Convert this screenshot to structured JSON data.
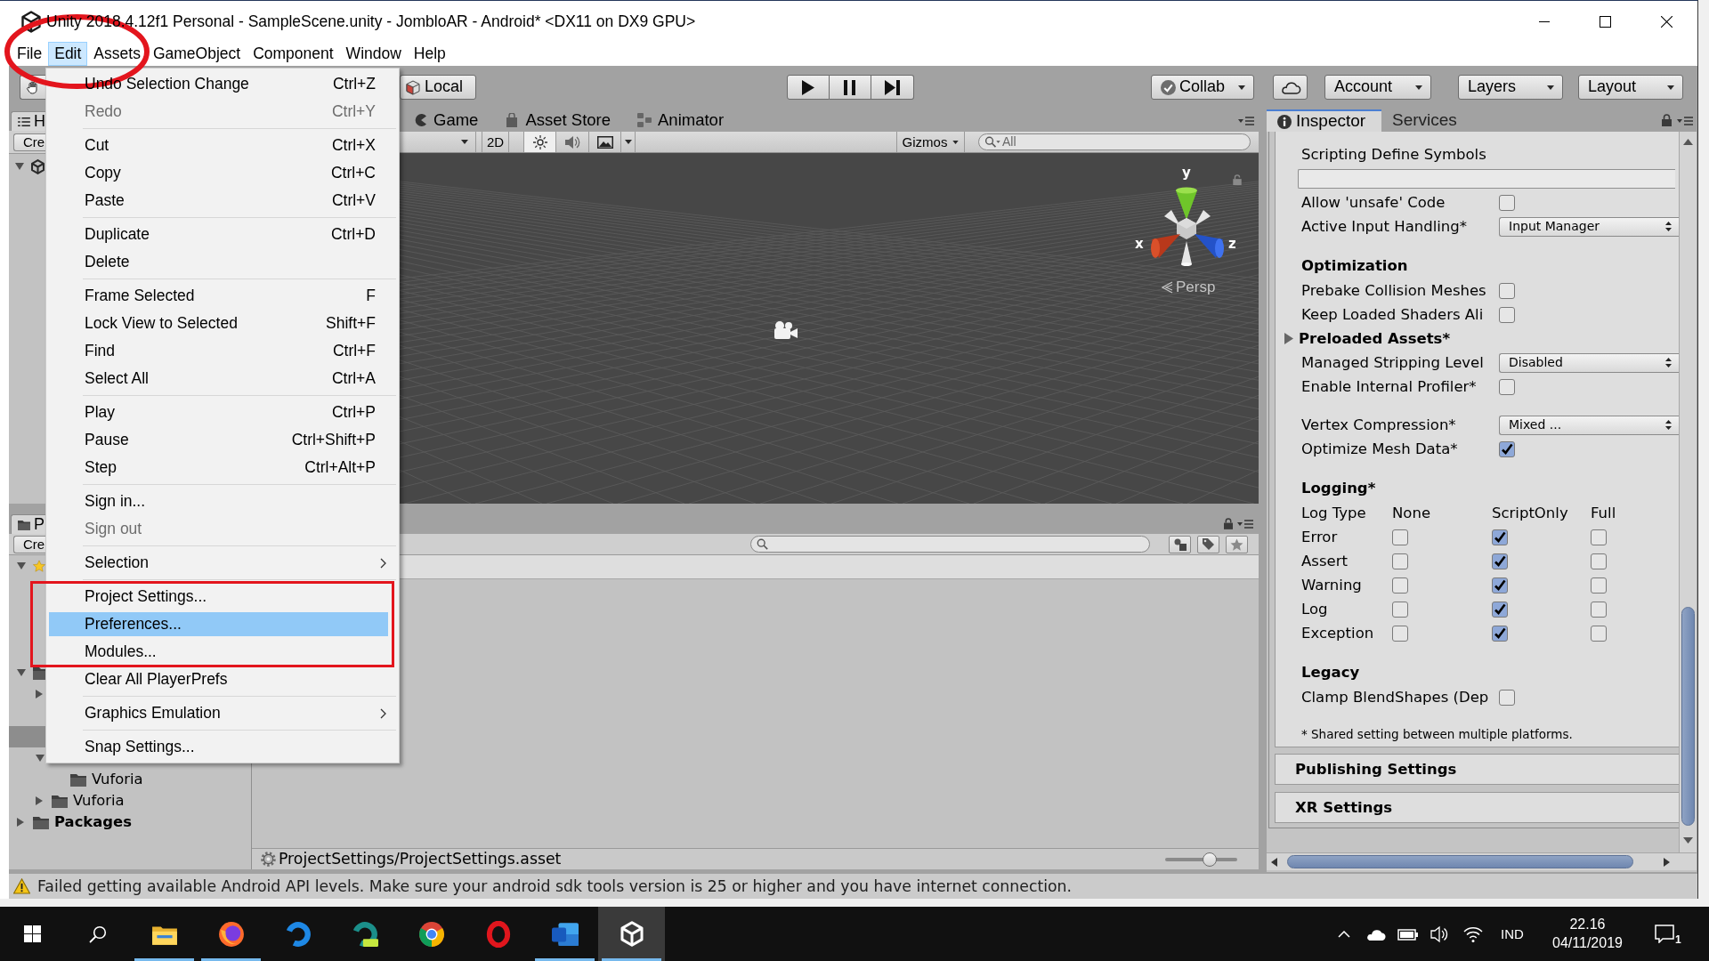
{
  "window": {
    "title": "Unity 2018.4.12f1 Personal - SampleScene.unity - JombloAR - Android* <DX11 on DX9 GPU>"
  },
  "menu_bar": [
    {
      "label": "File",
      "selected": false,
      "circled": true
    },
    {
      "label": "Edit",
      "selected": true,
      "circled": true
    },
    {
      "label": "Assets",
      "selected": false,
      "circled": true
    },
    {
      "label": "GameObject",
      "selected": false,
      "circled": false
    },
    {
      "label": "Component",
      "selected": false,
      "circled": false
    },
    {
      "label": "Window",
      "selected": false,
      "circled": false
    },
    {
      "label": "Help",
      "selected": false,
      "circled": false
    }
  ],
  "edit_menu": {
    "items": [
      {
        "kind": "item",
        "label": "Undo Selection Change",
        "shortcut": "Ctrl+Z",
        "disabled": false,
        "selected": false,
        "boxed": false
      },
      {
        "kind": "item",
        "label": "Redo",
        "shortcut": "Ctrl+Y",
        "disabled": true,
        "selected": false,
        "boxed": false
      },
      {
        "kind": "separator"
      },
      {
        "kind": "item",
        "label": "Cut",
        "shortcut": "Ctrl+X",
        "disabled": false,
        "selected": false,
        "boxed": false
      },
      {
        "kind": "item",
        "label": "Copy",
        "shortcut": "Ctrl+C",
        "disabled": false,
        "selected": false,
        "boxed": false
      },
      {
        "kind": "item",
        "label": "Paste",
        "shortcut": "Ctrl+V",
        "disabled": false,
        "selected": false,
        "boxed": false
      },
      {
        "kind": "separator"
      },
      {
        "kind": "item",
        "label": "Duplicate",
        "shortcut": "Ctrl+D",
        "disabled": false,
        "selected": false,
        "boxed": false
      },
      {
        "kind": "item",
        "label": "Delete",
        "disabled": false,
        "selected": false,
        "boxed": false
      },
      {
        "kind": "separator"
      },
      {
        "kind": "item",
        "label": "Frame Selected",
        "shortcut": "F",
        "disabled": false,
        "selected": false,
        "boxed": false
      },
      {
        "kind": "item",
        "label": "Lock View to Selected",
        "shortcut": "Shift+F",
        "disabled": false,
        "selected": false,
        "boxed": false
      },
      {
        "kind": "item",
        "label": "Find",
        "shortcut": "Ctrl+F",
        "disabled": false,
        "selected": false,
        "boxed": false
      },
      {
        "kind": "item",
        "label": "Select All",
        "shortcut": "Ctrl+A",
        "disabled": false,
        "selected": false,
        "boxed": false
      },
      {
        "kind": "separator"
      },
      {
        "kind": "item",
        "label": "Play",
        "shortcut": "Ctrl+P",
        "disabled": false,
        "selected": false,
        "boxed": false
      },
      {
        "kind": "item",
        "label": "Pause",
        "shortcut": "Ctrl+Shift+P",
        "disabled": false,
        "selected": false,
        "boxed": false
      },
      {
        "kind": "item",
        "label": "Step",
        "shortcut": "Ctrl+Alt+P",
        "disabled": false,
        "selected": false,
        "boxed": false
      },
      {
        "kind": "separator"
      },
      {
        "kind": "item",
        "label": "Sign in...",
        "disabled": false,
        "selected": false,
        "boxed": false
      },
      {
        "kind": "item",
        "label": "Sign out",
        "disabled": true,
        "selected": false,
        "boxed": false
      },
      {
        "kind": "separator"
      },
      {
        "kind": "submenu",
        "label": "Selection",
        "disabled": false,
        "selected": false,
        "boxed": false
      },
      {
        "kind": "separator"
      },
      {
        "kind": "item",
        "label": "Project Settings...",
        "disabled": false,
        "selected": false,
        "boxed": true
      },
      {
        "kind": "item",
        "label": "Preferences...",
        "disabled": false,
        "selected": true,
        "boxed": true
      },
      {
        "kind": "item",
        "label": "Modules...",
        "disabled": false,
        "selected": false,
        "boxed": true
      },
      {
        "kind": "item",
        "label": "Clear All PlayerPrefs",
        "disabled": false,
        "selected": false,
        "boxed": false
      },
      {
        "kind": "separator"
      },
      {
        "kind": "submenu",
        "label": "Graphics Emulation",
        "disabled": false,
        "selected": false,
        "boxed": false
      },
      {
        "kind": "separator"
      },
      {
        "kind": "item",
        "label": "Snap Settings...",
        "disabled": false,
        "selected": false,
        "boxed": false
      }
    ]
  },
  "toolbar": {
    "pivot_rotation": "Local",
    "collab": "Collab",
    "account": "Account",
    "layers": "Layers",
    "layout": "Layout"
  },
  "hierarchy": {
    "tab": "H",
    "create": "Cre",
    "scene": {
      "expanded": true
    }
  },
  "scene_view": {
    "tabs": [
      {
        "kind": "game",
        "label": "Game",
        "selected": false
      },
      {
        "kind": "asset_store",
        "label": "Asset Store",
        "selected": false
      },
      {
        "kind": "animator",
        "label": "Animator",
        "selected": false
      }
    ],
    "mode_2d": {
      "label": "2D",
      "on": false
    },
    "lighting": true,
    "audio": false,
    "effects": false,
    "gizmos": "Gizmos",
    "search": {
      "placeholder": "All"
    },
    "axes": {
      "x": "x",
      "y": "y",
      "z": "z"
    },
    "projection": "Persp"
  },
  "project": {
    "tab": "P",
    "create": "Cre",
    "favorites": {
      "expanded": true
    },
    "tree": [
      {
        "expanded": true,
        "selected": false,
        "children": [
          {
            "expanded": false,
            "selected": false
          },
          {
            "selected": true
          },
          {
            "expanded": true,
            "selected": false,
            "children": [
              {
                "label": "Vuforia",
                "selected": false
              }
            ]
          },
          {
            "label": "Vuforia",
            "expanded": false,
            "selected": false
          }
        ]
      },
      {
        "label": "Packages",
        "expanded": false,
        "selected": false
      }
    ],
    "footer_path": "ProjectSettings/ProjectSettings.asset",
    "zoom_slider": {
      "level": 0.62
    }
  },
  "inspector": {
    "tabs": [
      {
        "kind": "inspector",
        "label": "Inspector",
        "selected": true
      },
      {
        "kind": "services",
        "label": "Services",
        "selected": false
      }
    ],
    "groups": [
      {
        "items": [
          {
            "kind": "label",
            "label": "Scripting Define Symbols"
          },
          {
            "kind": "text_field"
          },
          {
            "kind": "checkbox",
            "label": "Allow 'unsafe' Code",
            "checked": false
          },
          {
            "kind": "dropdown",
            "label": "Active Input Handling*",
            "value": "Input Manager"
          }
        ]
      },
      {
        "items": [
          {
            "kind": "heading",
            "label": "Optimization"
          },
          {
            "kind": "checkbox",
            "label": "Prebake Collision Meshes",
            "checked": false
          },
          {
            "kind": "checkbox",
            "label": "Keep Loaded Shaders Ali",
            "checked": false
          },
          {
            "kind": "foldout",
            "label": "Preloaded Assets*",
            "expanded": false
          },
          {
            "kind": "dropdown",
            "label": "Managed Stripping Level",
            "value": "Disabled"
          },
          {
            "kind": "checkbox",
            "label": "Enable Internal Profiler*",
            "checked": false
          }
        ]
      },
      {
        "items": [
          {
            "kind": "dropdown",
            "label": "Vertex Compression*",
            "value": "Mixed ..."
          },
          {
            "kind": "checkbox",
            "label": "Optimize Mesh Data*",
            "checked": true
          }
        ]
      },
      {
        "items": [
          {
            "kind": "heading",
            "label": "Logging*"
          },
          {
            "kind": "log_header",
            "columns": [
              "Log Type",
              "None",
              "ScriptOnly",
              "Full"
            ]
          },
          {
            "kind": "log_row",
            "label": "Error",
            "checks": [
              false,
              true,
              false
            ]
          },
          {
            "kind": "log_row",
            "label": "Assert",
            "checks": [
              false,
              true,
              false
            ]
          },
          {
            "kind": "log_row",
            "label": "Warning",
            "checks": [
              false,
              true,
              false
            ]
          },
          {
            "kind": "log_row",
            "label": "Log",
            "checks": [
              false,
              true,
              false
            ]
          },
          {
            "kind": "log_row",
            "label": "Exception",
            "checks": [
              false,
              true,
              false
            ]
          }
        ]
      },
      {
        "items": [
          {
            "kind": "heading",
            "label": "Legacy"
          },
          {
            "kind": "checkbox",
            "label": "Clamp BlendShapes (Dep",
            "checked": false
          }
        ]
      },
      {
        "items": [
          {
            "kind": "note",
            "label": "* Shared setting between multiple platforms."
          }
        ]
      }
    ],
    "sections": [
      "Publishing Settings",
      "XR Settings"
    ]
  },
  "status_bar": {
    "message": "Failed getting available Android API levels. Make sure your android sdk tools version is 25 or higher and you have internet connection."
  },
  "taskbar": {
    "apps": [
      {
        "kind": "explorer",
        "running": true,
        "selected": false
      },
      {
        "kind": "firefox",
        "running": true,
        "selected": false
      },
      {
        "kind": "edge",
        "running": false,
        "selected": false
      },
      {
        "kind": "edge_dev",
        "running": false,
        "selected": false
      },
      {
        "kind": "chrome",
        "running": false,
        "selected": false
      },
      {
        "kind": "opera",
        "running": false,
        "selected": false
      },
      {
        "kind": "word",
        "running": true,
        "selected": false
      },
      {
        "kind": "unity",
        "running": true,
        "selected": true
      }
    ],
    "tray": {
      "language": "IND",
      "time": "22.16",
      "date": "04/11/2019",
      "notification_count": "1"
    }
  }
}
